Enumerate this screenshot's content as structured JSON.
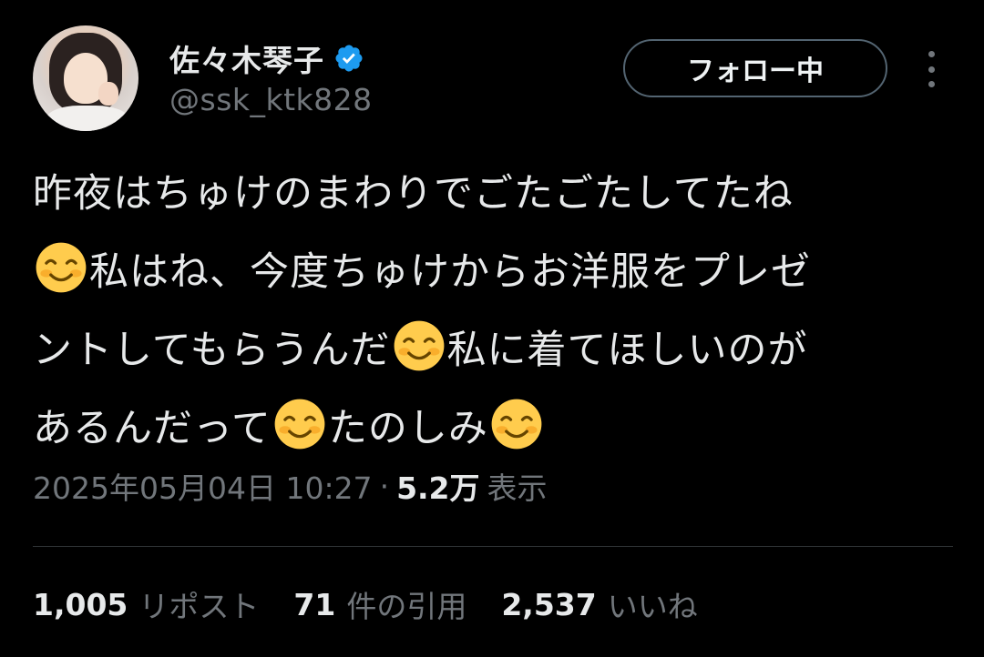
{
  "author": {
    "display_name": "佐々木琴子",
    "handle": "@ssk_ktk828",
    "verified_color": "#1d9bf0"
  },
  "actions": {
    "follow_label": "フォロー中",
    "more_icon": "more-vertical-icon"
  },
  "tweet": {
    "line1": "昨夜はちゅけのまわりでごたごたしてたね",
    "line2_text": "私はね、今度ちゅけからお洋服をプレゼ",
    "line3_a": "ントしてもらうんだ",
    "line3_b": "私に着てほしいのが",
    "line4_a": "あるんだって",
    "line4_b": "たのしみ",
    "emoji": "smiling-face-icon"
  },
  "meta": {
    "timestamp": "2025年05月04日 10:27",
    "separator": "·",
    "views_count": "5.2万",
    "views_label": "表示"
  },
  "stats": {
    "reposts_count": "1,005",
    "reposts_label": "リポスト",
    "quotes_count": "71",
    "quotes_label": "件の引用",
    "likes_count": "2,537",
    "likes_label": "いいね"
  }
}
